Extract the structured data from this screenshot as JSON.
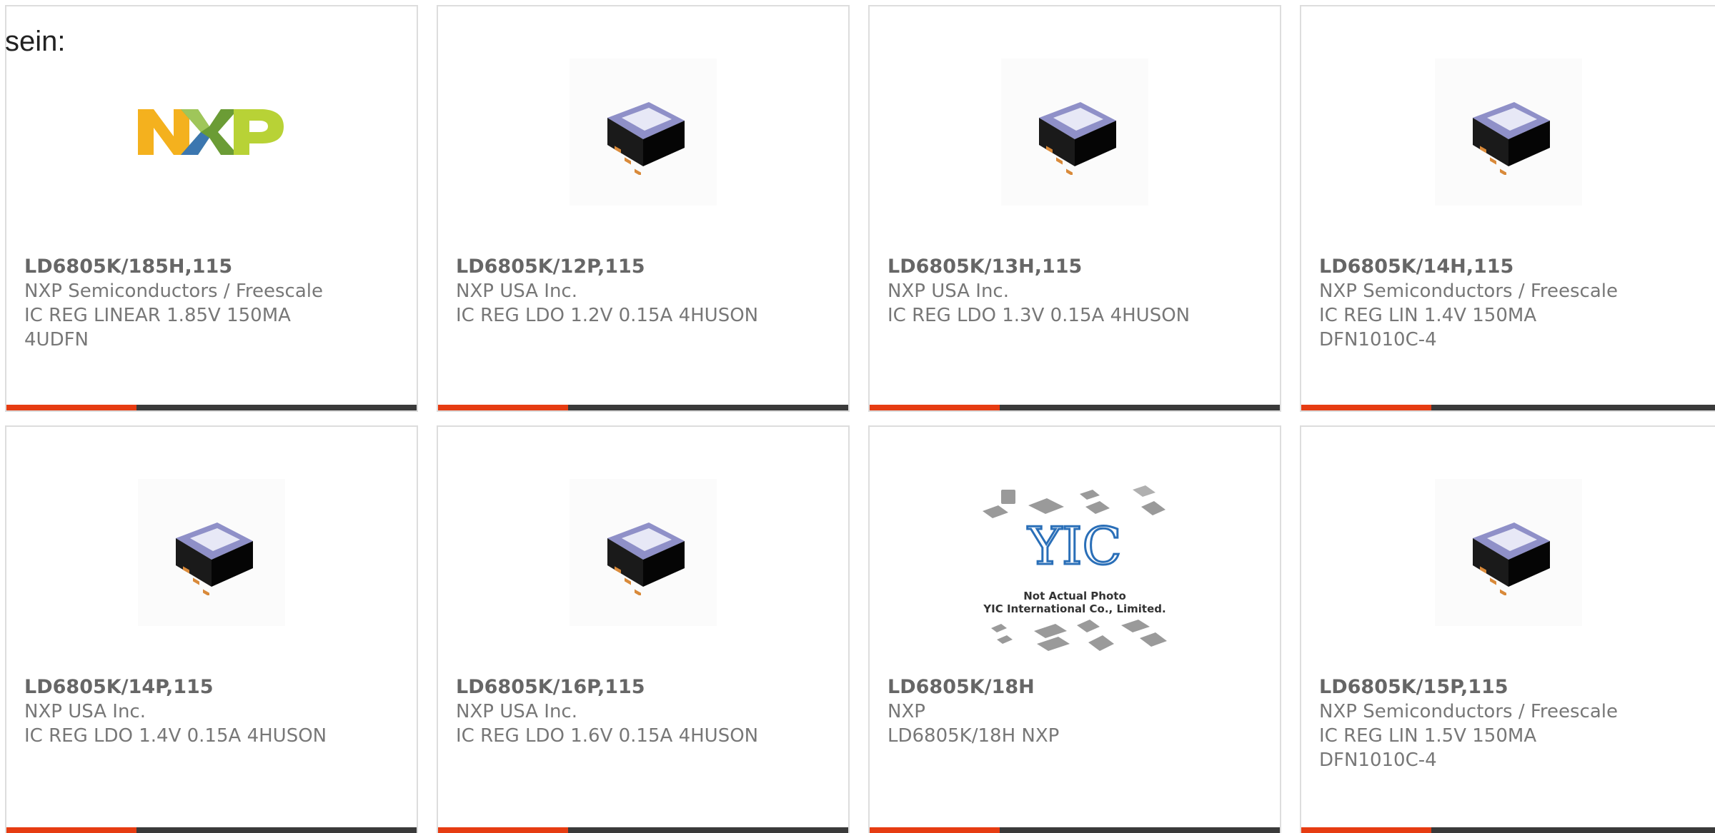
{
  "header": {
    "fragment": "sein:"
  },
  "products": [
    {
      "part": "LD6805K/185H,115",
      "maker": "NXP Semiconductors / Freescale",
      "desc1": "IC REG LINEAR 1.85V 150MA",
      "desc2": "4UDFN",
      "image": "nxp-logo"
    },
    {
      "part": "LD6805K/12P,115",
      "maker": "NXP USA Inc.",
      "desc1": "IC REG LDO 1.2V 0.15A 4HUSON",
      "desc2": "",
      "image": "chip-package-icon"
    },
    {
      "part": "LD6805K/13H,115",
      "maker": "NXP USA Inc.",
      "desc1": "IC REG LDO 1.3V 0.15A 4HUSON",
      "desc2": "",
      "image": "chip-package-icon"
    },
    {
      "part": "LD6805K/14H,115",
      "maker": "NXP Semiconductors / Freescale",
      "desc1": "IC REG LIN 1.4V 150MA",
      "desc2": "DFN1010C-4",
      "image": "chip-package-icon"
    },
    {
      "part": "LD6805K/14P,115",
      "maker": "NXP USA Inc.",
      "desc1": "IC REG LDO 1.4V 0.15A 4HUSON",
      "desc2": "",
      "image": "chip-package-icon"
    },
    {
      "part": "LD6805K/16P,115",
      "maker": "NXP USA Inc.",
      "desc1": "IC REG LDO 1.6V 0.15A 4HUSON",
      "desc2": "",
      "image": "chip-package-icon"
    },
    {
      "part": "LD6805K/18H",
      "maker": "NXP",
      "desc1": "LD6805K/18H NXP",
      "desc2": "",
      "image": "yic-placeholder",
      "placeholder_caption1": "Not Actual Photo",
      "placeholder_caption2": "YIC International Co., Limited."
    },
    {
      "part": "LD6805K/15P,115",
      "maker": "NXP Semiconductors / Freescale",
      "desc1": "IC REG LIN 1.5V 150MA",
      "desc2": "DFN1010C-4",
      "image": "chip-package-icon"
    }
  ],
  "colors": {
    "accent": "#e63c12",
    "bar": "#3a3a3a",
    "border": "#dddddd",
    "text": "#777777"
  }
}
